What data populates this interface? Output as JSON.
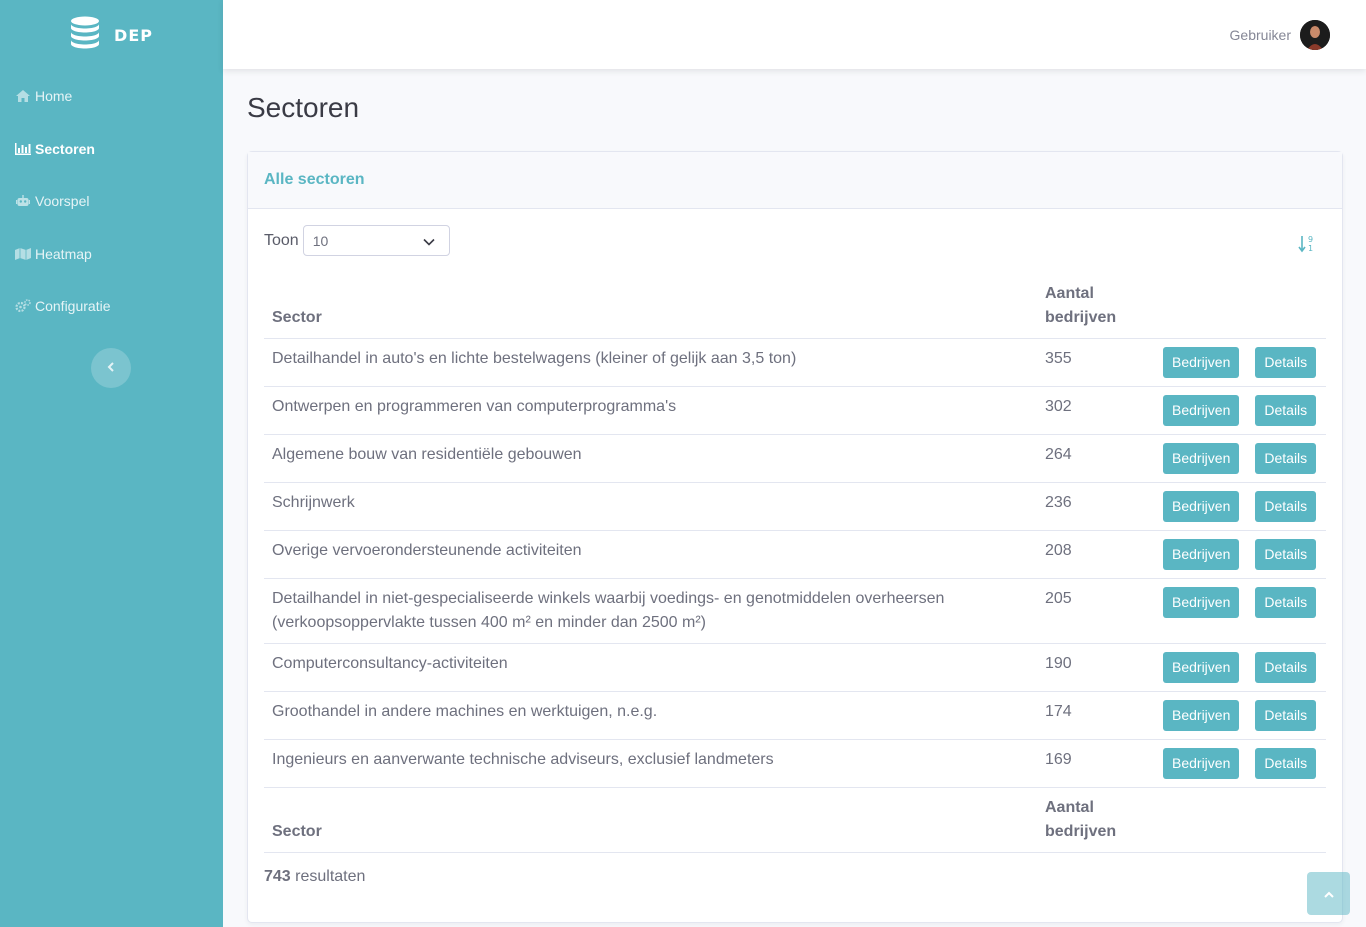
{
  "brand": {
    "name": "DEP",
    "icon": "database-icon"
  },
  "sidebar": {
    "items": [
      {
        "label": "Home",
        "icon": "home-icon",
        "active": false
      },
      {
        "label": "Sectoren",
        "icon": "bar-chart-icon",
        "active": true
      },
      {
        "label": "Voorspel",
        "icon": "robot-icon",
        "active": false
      },
      {
        "label": "Heatmap",
        "icon": "map-icon",
        "active": false
      },
      {
        "label": "Configuratie",
        "icon": "cogs-icon",
        "active": false
      }
    ],
    "toggle_icon": "chevron-left-icon"
  },
  "topbar": {
    "user_name": "Gebruiker"
  },
  "page": {
    "title": "Sectoren"
  },
  "card": {
    "title": "Alle sectoren",
    "toon_label": "Toon",
    "page_size": "10",
    "sort_icon": "sort-numeric-down-alt-icon"
  },
  "table": {
    "headers": {
      "sector": "Sector",
      "count": "Aantal bedrijven"
    },
    "rows": [
      {
        "sector": "Detailhandel in auto's en lichte bestelwagens (kleiner of gelijk aan 3,5 ton)",
        "count": "355"
      },
      {
        "sector": "Ontwerpen en programmeren van computerprogramma's",
        "count": "302"
      },
      {
        "sector": "Algemene bouw van residentiële gebouwen",
        "count": "264"
      },
      {
        "sector": "Schrijnwerk",
        "count": "236"
      },
      {
        "sector": "Overige vervoerondersteunende activiteiten",
        "count": "208"
      },
      {
        "sector": "Detailhandel in niet-gespecialiseerde winkels waarbij voedings- en genotmiddelen overheersen (verkoopsoppervlakte tussen 400 m² en minder dan 2500 m²)",
        "count": "205"
      },
      {
        "sector": "Computerconsultancy-activiteiten",
        "count": "190"
      },
      {
        "sector": "Groothandel in andere machines en werktuigen, n.e.g.",
        "count": "174"
      },
      {
        "sector": "Ingenieurs en aanverwante technische adviseurs, exclusief landmeters",
        "count": "169"
      }
    ],
    "buttons": {
      "companies": "Bedrijven",
      "details": "Details"
    }
  },
  "results": {
    "count": "743",
    "label": "resultaten"
  },
  "colors": {
    "primary": "#5ab6c3",
    "text": "#6e707e",
    "title": "#3a3b45",
    "background": "#f8f9fc"
  }
}
